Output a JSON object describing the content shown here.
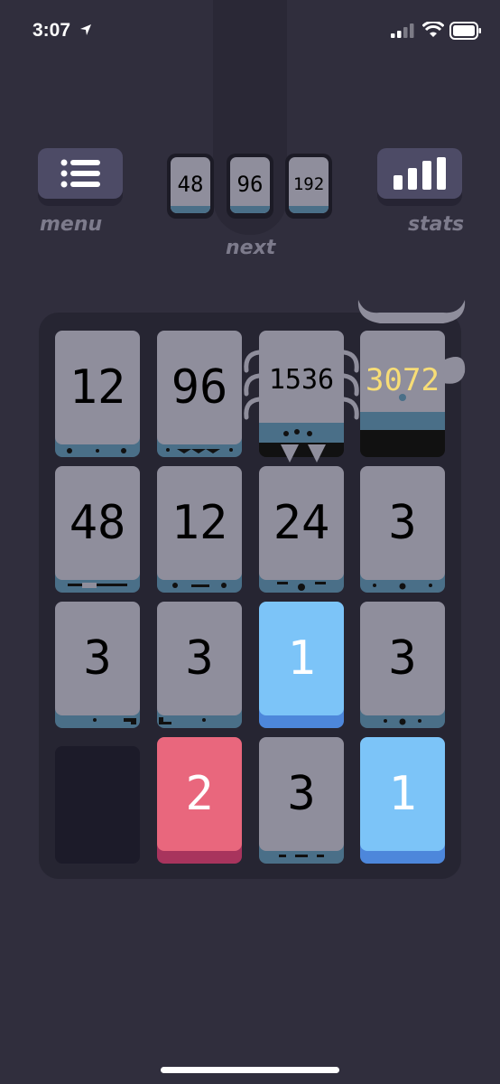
{
  "status_bar": {
    "time": "3:07"
  },
  "toolbar": {
    "menu_label": "menu",
    "stats_label": "stats",
    "next_label": "next"
  },
  "next_cards": [
    "48",
    "96",
    "192"
  ],
  "board": {
    "rows": [
      [
        "12",
        "96",
        "1536",
        "3072"
      ],
      [
        "48",
        "12",
        "24",
        "3"
      ],
      [
        "3",
        "3",
        "1",
        "3"
      ],
      [
        "",
        "2",
        "3",
        "1"
      ]
    ]
  },
  "colors": {
    "background": "#302e3d",
    "board": "#262532",
    "tile_gray": "#8f8e9c",
    "tile_blue": "#7cc4f8",
    "tile_red": "#e9677d",
    "highlight_gold": "#f7dd76"
  },
  "icons": [
    "location-arrow-icon",
    "signal-icon",
    "wifi-icon",
    "battery-icon",
    "menu-list-icon",
    "stats-bars-icon"
  ]
}
